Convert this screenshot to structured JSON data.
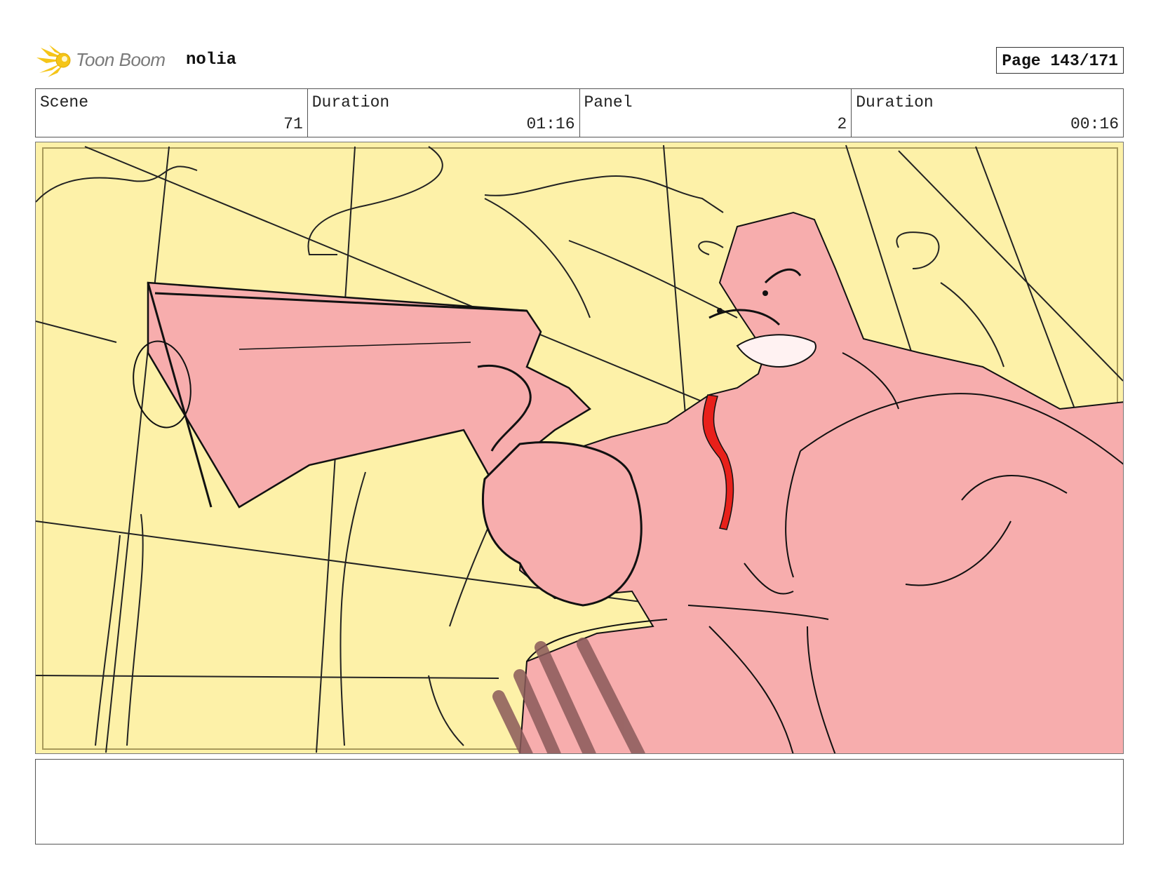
{
  "header": {
    "brand": "Toon Boom",
    "project": "nolia",
    "page": "Page 143/171",
    "logo_icon": "toon-boom-star-logo-icon"
  },
  "info": {
    "scene_label": "Scene",
    "scene_value": "71",
    "scene_duration_label": "Duration",
    "scene_duration_value": "01:16",
    "panel_label": "Panel",
    "panel_value": "2",
    "panel_duration_label": "Duration",
    "panel_duration_value": "00:16"
  },
  "panel": {
    "background_color": "#fdf1a8",
    "figure_color": "#f7adad",
    "accent_color": "#e8201a"
  },
  "notes": {
    "text": ""
  }
}
